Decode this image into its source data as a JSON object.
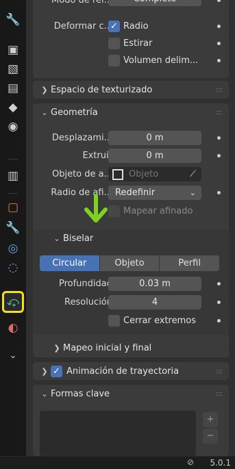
{
  "sidebar": {
    "tabs": [
      {
        "name": "tool-icon",
        "glyph": "🔧"
      },
      {
        "name": "render-icon",
        "glyph": "▣"
      },
      {
        "name": "output-icon",
        "glyph": "🖨"
      },
      {
        "name": "view-layer-icon",
        "glyph": "▤"
      },
      {
        "name": "scene-icon",
        "glyph": "◆"
      },
      {
        "name": "world-icon",
        "glyph": "◉"
      },
      {
        "name": "collection-icon",
        "glyph": "▥"
      },
      {
        "name": "object-icon",
        "glyph": "▢"
      },
      {
        "name": "modifier-icon",
        "glyph": "🔧"
      },
      {
        "name": "particles-icon",
        "glyph": "◎"
      },
      {
        "name": "physics-icon",
        "glyph": "◌"
      },
      {
        "name": "curve-data-icon",
        "glyph": "⤽"
      },
      {
        "name": "material-icon",
        "glyph": "◐"
      },
      {
        "name": "more-icon",
        "glyph": "⌄"
      }
    ]
  },
  "top": {
    "modo_label": "Modo de rel...",
    "modo_value": "Completo",
    "deformar_label": "Deformar c...",
    "radio": "Radio",
    "estirar": "Estirar",
    "volumen": "Volumen delim..."
  },
  "texturizado": {
    "title": "Espacio de texturizado"
  },
  "geometria": {
    "title": "Geometría",
    "desplazamiento_label": "Desplazami...",
    "desplazamiento_value": "0 m",
    "extruir_label": "Extruir",
    "extruir_value": "0 m",
    "objeto_label": "Objeto de a...",
    "objeto_placeholder": "Objeto",
    "radio_label": "Radio de afi...",
    "radio_value": "Redefinir",
    "mapear": "Mapear afinado"
  },
  "biselar": {
    "title": "Biselar",
    "tabs": [
      "Circular",
      "Objeto",
      "Perfil"
    ],
    "profundidad_label": "Profundidad",
    "profundidad_value": "0.03 m",
    "resolucion_label": "Resolución",
    "resolucion_value": "4",
    "cerrar": "Cerrar extremos"
  },
  "mapeo": {
    "title": "Mapeo inicial y final"
  },
  "animacion": {
    "title": "Animación de trayectoria"
  },
  "formas": {
    "title": "Formas clave"
  },
  "status": {
    "version": "5.0.1"
  }
}
